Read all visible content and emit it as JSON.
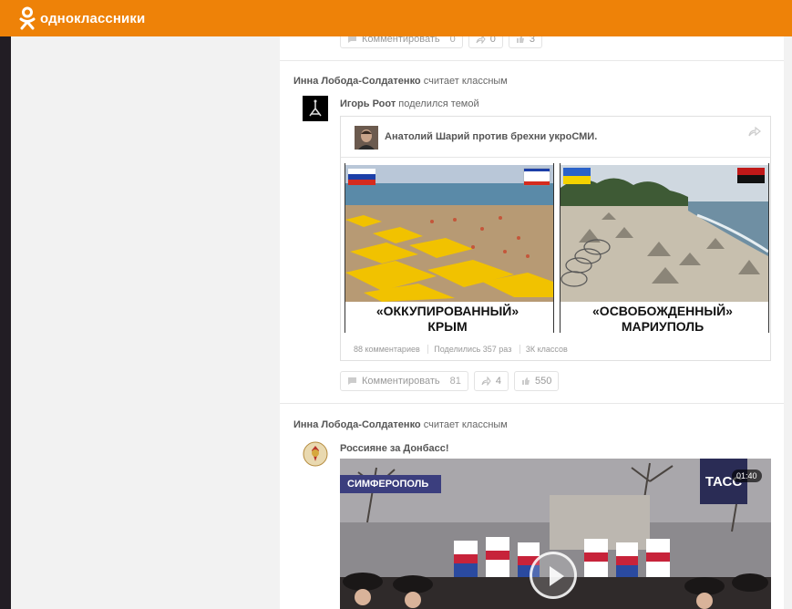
{
  "header": {
    "logo_text": "одноклассники",
    "brand_color": "#ee8208"
  },
  "top_actions": {
    "comment_label": "Комментировать",
    "comment_count": "0",
    "share_count": "0",
    "like_count": "3"
  },
  "post1": {
    "liker_name": "Инна Лобода-Солдатенко",
    "liker_action": "считает классным",
    "author_name": "Игорь Роот",
    "author_action": "поделился темой",
    "shared": {
      "title": "Анатолий Шарий против брехни укроСМИ.",
      "left_caption_line1": "«ОККУПИРОВАННЫЙ»",
      "left_caption_line2": "КРЫМ",
      "right_caption_line1": "«ОСВОБОЖДЕННЫЙ»",
      "right_caption_line2": "МАРИУПОЛЬ",
      "stats": [
        "88 комментариев",
        "Поделились 357 раз",
        "3К классов"
      ]
    },
    "actions": {
      "comment_label": "Комментировать",
      "comment_count": "81",
      "share_count": "4",
      "like_count": "550"
    }
  },
  "post2": {
    "liker_name": "Инна Лобода-Солдатенко",
    "liker_action": "считает классным",
    "group_name": "Россияне за Донбасс!",
    "video": {
      "city_label": "СИМФЕРОПОЛЬ",
      "channel_logo": "ТАСС",
      "duration": "01:40"
    }
  }
}
